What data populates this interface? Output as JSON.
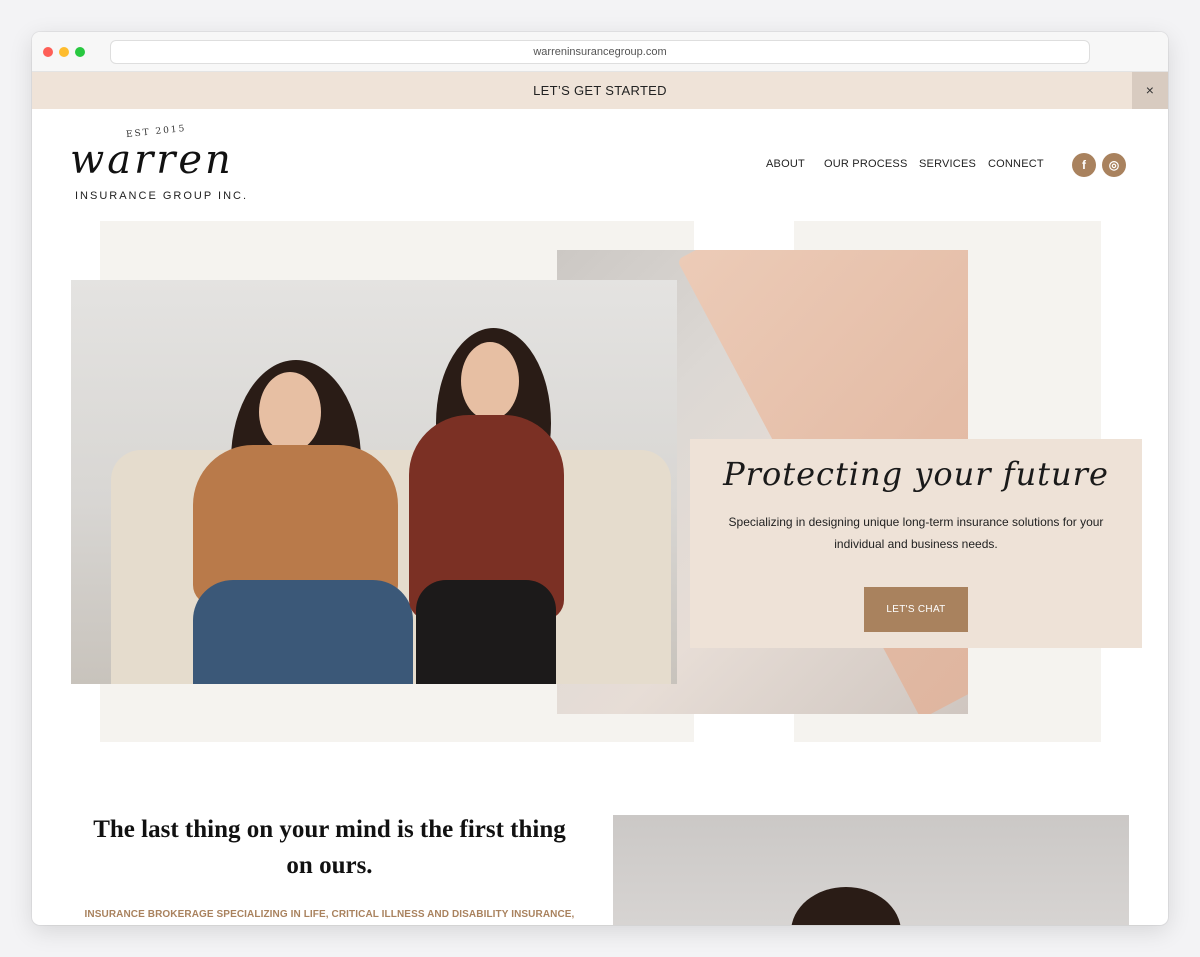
{
  "browser": {
    "url": "warreninsurancegroup.com"
  },
  "banner": {
    "text": "LET’S GET STARTED",
    "close_label": "×"
  },
  "logo": {
    "est": "EST 2015",
    "script": "warren",
    "subtitle": "INSURANCE GROUP INC."
  },
  "nav": {
    "items": [
      {
        "label": "ABOUT"
      },
      {
        "label": "OUR PROCESS"
      },
      {
        "label": "SERVICES"
      },
      {
        "label": "CONNECT"
      }
    ]
  },
  "social": {
    "facebook_glyph": "f",
    "instagram_glyph": "◎"
  },
  "hero": {
    "title": "Protecting your future",
    "description": "Specializing in designing unique long-term insurance solutions for your individual and business needs.",
    "button_label": "LET'S CHAT"
  },
  "section2": {
    "headline": "The last thing on your mind is the first thing on ours.",
    "subheadline": "INSURANCE BROKERAGE SPECIALIZING IN LIFE, CRITICAL ILLNESS AND DISABILITY INSURANCE,"
  },
  "colors": {
    "accent": "#a9825e",
    "banner_bg": "#efe3d8",
    "card_bg": "#eee2d7"
  }
}
